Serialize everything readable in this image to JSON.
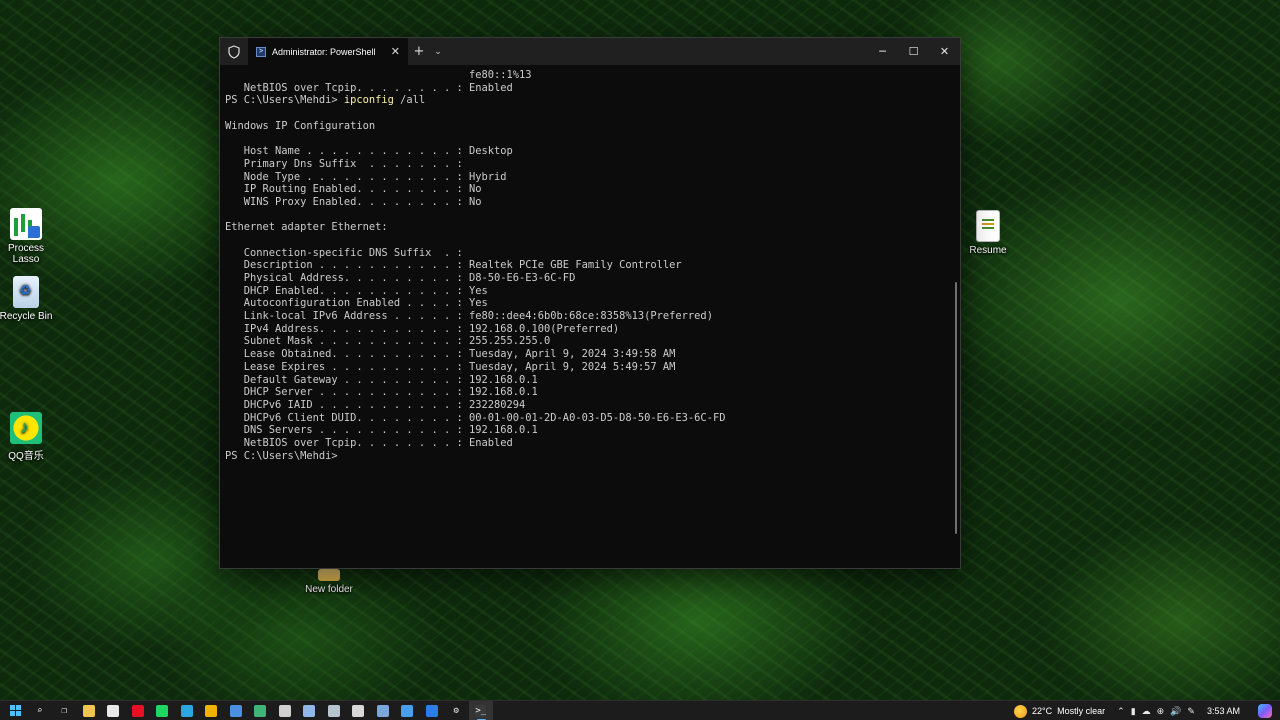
{
  "desktop": {
    "icons": [
      {
        "label": "Process Lasso",
        "icon": "process-lasso-icon"
      },
      {
        "label": "Recycle Bin",
        "icon": "recycle-bin-icon"
      },
      {
        "label": "QQ音乐",
        "icon": "qq-music-icon"
      },
      {
        "label": "Resume",
        "icon": "document-icon"
      },
      {
        "label": "New folder",
        "icon": "folder-icon"
      }
    ]
  },
  "window": {
    "tab_title": "Administrator: PowerShell",
    "new_tab": "+",
    "dropdown": "⌄",
    "controls": {
      "minimize": "─",
      "maximize": "☐",
      "close": "✕"
    }
  },
  "terminal": {
    "lines": [
      {
        "text": "                                       fe80::1%13"
      },
      {
        "text": "   NetBIOS over Tcpip. . . . . . . . : Enabled"
      },
      {
        "prompt": "PS C:\\Users\\Mehdi> ",
        "cmd": "ipconfig",
        "args": " /all"
      },
      {
        "text": ""
      },
      {
        "text": "Windows IP Configuration"
      },
      {
        "text": ""
      },
      {
        "text": "   Host Name . . . . . . . . . . . . : Desktop"
      },
      {
        "text": "   Primary Dns Suffix  . . . . . . . :"
      },
      {
        "text": "   Node Type . . . . . . . . . . . . : Hybrid"
      },
      {
        "text": "   IP Routing Enabled. . . . . . . . : No"
      },
      {
        "text": "   WINS Proxy Enabled. . . . . . . . : No"
      },
      {
        "text": ""
      },
      {
        "text": "Ethernet adapter Ethernet:"
      },
      {
        "text": ""
      },
      {
        "text": "   Connection-specific DNS Suffix  . :"
      },
      {
        "text": "   Description . . . . . . . . . . . : Realtek PCIe GBE Family Controller"
      },
      {
        "text": "   Physical Address. . . . . . . . . : D8-50-E6-E3-6C-FD"
      },
      {
        "text": "   DHCP Enabled. . . . . . . . . . . : Yes"
      },
      {
        "text": "   Autoconfiguration Enabled . . . . : Yes"
      },
      {
        "text": "   Link-local IPv6 Address . . . . . : fe80::dee4:6b0b:68ce:8358%13(Preferred)"
      },
      {
        "text": "   IPv4 Address. . . . . . . . . . . : 192.168.0.100(Preferred)"
      },
      {
        "text": "   Subnet Mask . . . . . . . . . . . : 255.255.255.0"
      },
      {
        "text": "   Lease Obtained. . . . . . . . . . : Tuesday, April 9, 2024 3:49:58 AM"
      },
      {
        "text": "   Lease Expires . . . . . . . . . . : Tuesday, April 9, 2024 5:49:57 AM"
      },
      {
        "text": "   Default Gateway . . . . . . . . . : 192.168.0.1"
      },
      {
        "text": "   DHCP Server . . . . . . . . . . . : 192.168.0.1"
      },
      {
        "text": "   DHCPv6 IAID . . . . . . . . . . . : 232280294"
      },
      {
        "text": "   DHCPv6 Client DUID. . . . . . . . : 00-01-00-01-2D-A0-03-D5-D8-50-E6-E3-6C-FD"
      },
      {
        "text": "   DNS Servers . . . . . . . . . . . : 192.168.0.1"
      },
      {
        "text": "   NetBIOS over Tcpip. . . . . . . . : Enabled"
      },
      {
        "prompt": "PS C:\\Users\\Mehdi>",
        "cmd": "",
        "args": ""
      }
    ],
    "command_color": "#f9f1a5",
    "text_color": "#cccccc"
  },
  "taskbar": {
    "apps": [
      {
        "name": "search-icon",
        "color": "transparent",
        "glyph": "⌕"
      },
      {
        "name": "task-view-icon",
        "color": "transparent",
        "glyph": "❐"
      },
      {
        "name": "file-explorer-icon",
        "color": "#f3c44d"
      },
      {
        "name": "media-player-icon",
        "color": "#e8e8e8"
      },
      {
        "name": "recording-icon",
        "color": "#e81123"
      },
      {
        "name": "spotify-icon",
        "color": "#1ed760"
      },
      {
        "name": "edge-icon",
        "color": "#2aa7e0"
      },
      {
        "name": "chrome-icon",
        "color": "#f0b400"
      },
      {
        "name": "browser-icon",
        "color": "#4a8fe0"
      },
      {
        "name": "edge-dev-icon",
        "color": "#3fb57a"
      },
      {
        "name": "notepad-icon",
        "color": "#d0d0d0"
      },
      {
        "name": "photos-icon",
        "color": "#8fb8e8"
      },
      {
        "name": "calculator-icon",
        "color": "#b8c4d0"
      },
      {
        "name": "game-icon",
        "color": "#d8d8d8"
      },
      {
        "name": "keyboard-icon",
        "color": "#7aa8d8"
      },
      {
        "name": "remote-desktop-icon",
        "color": "#4aa0e8"
      },
      {
        "name": "app-store-icon",
        "color": "#2b7de9"
      },
      {
        "name": "settings-icon",
        "color": "transparent",
        "glyph": "⚙"
      },
      {
        "name": "terminal-icon",
        "color": "#3a3a3a",
        "glyph": ">_",
        "active": true
      }
    ],
    "weather": {
      "temp": "22°C",
      "condition": "Mostly clear"
    },
    "tray_glyphs": [
      "⌃",
      "▮",
      "☁",
      "⊕",
      "🔊",
      "✎"
    ],
    "time": "3:53 AM"
  }
}
